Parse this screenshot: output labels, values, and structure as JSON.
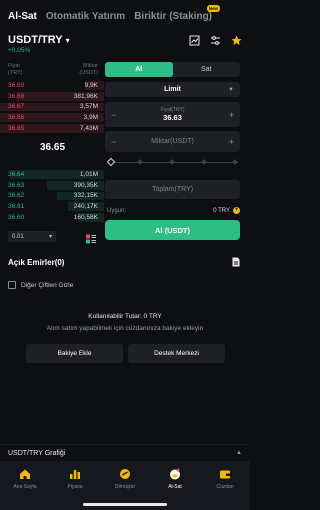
{
  "tabs": [
    {
      "label": "Al-Sat",
      "active": true
    },
    {
      "label": "Otomatik Yatırım",
      "active": false
    },
    {
      "label": "Biriktir (Staking)",
      "active": false,
      "badge": "New"
    }
  ],
  "pair": {
    "name": "USDT/TRY",
    "change": "+0.05%"
  },
  "orderbook": {
    "header_left": [
      "Fiyat",
      "(TRY)"
    ],
    "header_right": [
      "Miktar",
      "(USDT)"
    ],
    "asks": [
      {
        "price": "36.69",
        "qty": "9,9K",
        "depth": 0.18
      },
      {
        "price": "36.68",
        "qty": "381,96K",
        "depth": 0.85
      },
      {
        "price": "36.67",
        "qty": "3,57M",
        "depth": 1.0
      },
      {
        "price": "36.66",
        "qty": "3,9M",
        "depth": 1.0
      },
      {
        "price": "36.65",
        "qty": "7,43M",
        "depth": 1.0
      }
    ],
    "last_price": "36.65",
    "bids": [
      {
        "price": "36.64",
        "qty": "1,01M",
        "depth": 0.9
      },
      {
        "price": "36.63",
        "qty": "390,35K",
        "depth": 0.55
      },
      {
        "price": "36.62",
        "qty": "332,15K",
        "depth": 0.45
      },
      {
        "price": "36.61",
        "qty": "240,17K",
        "depth": 0.35
      },
      {
        "price": "36.60",
        "qty": "160,58K",
        "depth": 0.25
      }
    ],
    "decimals": "0.01"
  },
  "form": {
    "buy_tab": "Al",
    "sell_tab": "Sat",
    "order_type": "Limit",
    "price_label": "Fiyat(TRY)",
    "price_value": "36.63",
    "amount_placeholder": "Miktar(USDT)",
    "total_placeholder": "Toplam(TRY)",
    "available_label": "Uygun:",
    "available_value": "0 TRY",
    "buy_button": "Al (USDT)"
  },
  "orders": {
    "title": "Açık Emirler(0)",
    "hide_pairs_label": "Diğer Çiftleri Gizle"
  },
  "balance": {
    "available_text": "Kullanılabilir Tutar: 0 TRY",
    "message": "Alım satım yapabilmek için cüzdanınıza bakiye ekleyin",
    "add_balance_button": "Bakiye Ekle",
    "support_button": "Destek Merkezi"
  },
  "chart_toggle": "USDT/TRY Grafiği",
  "nav": [
    {
      "label": "Ana Sayfa",
      "icon": "home-icon",
      "active": false
    },
    {
      "label": "Piyasa",
      "icon": "market-icon",
      "active": false
    },
    {
      "label": "Dönüştür",
      "icon": "convert-icon",
      "active": false
    },
    {
      "label": "Al-Sat",
      "icon": "trade-icon",
      "active": true
    },
    {
      "label": "Cüzdan",
      "icon": "wallet-icon",
      "active": false
    }
  ],
  "colors": {
    "accent": "#2ebd85",
    "ask": "#f6465d",
    "brand": "#f0b90b",
    "background": "#0e0f13"
  }
}
